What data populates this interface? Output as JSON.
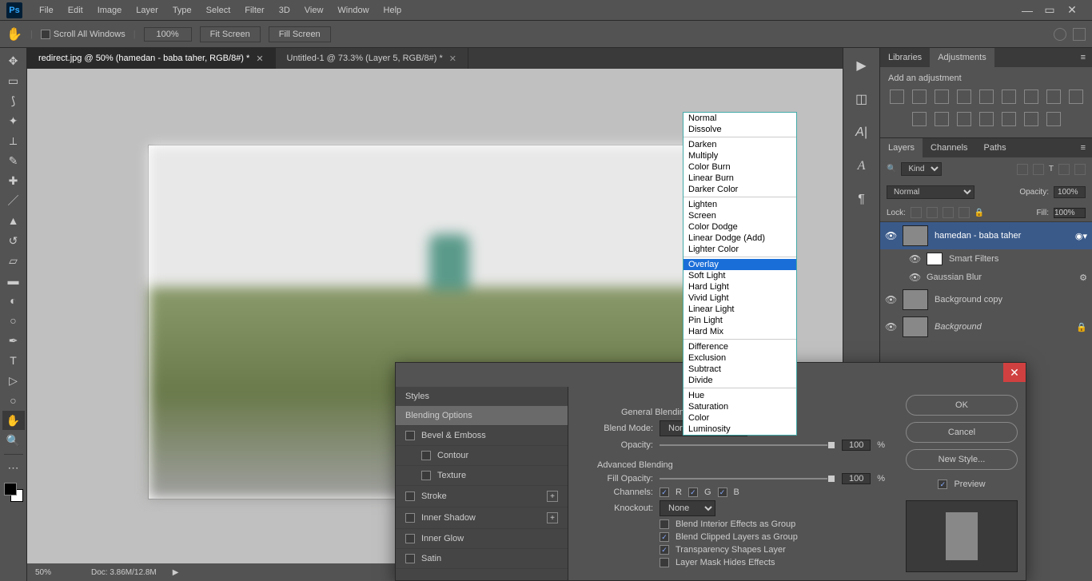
{
  "menubar": {
    "items": [
      "File",
      "Edit",
      "Image",
      "Layer",
      "Type",
      "Select",
      "Filter",
      "3D",
      "View",
      "Window",
      "Help"
    ]
  },
  "optbar": {
    "scroll_all": "Scroll All Windows",
    "zoom": "100%",
    "fit": "Fit Screen",
    "fill": "Fill Screen"
  },
  "tabs": [
    {
      "label": "redirect.jpg @ 50% (hamedan - baba taher, RGB/8#) *",
      "active": true
    },
    {
      "label": "Untitled-1 @ 73.3% (Layer 5, RGB/8#) *",
      "active": false
    }
  ],
  "status": {
    "zoom": "50%",
    "doc": "Doc: 3.86M/12.8M"
  },
  "panels": {
    "adj_tabs": [
      "Libraries",
      "Adjustments"
    ],
    "adj_title": "Add an adjustment",
    "layer_tabs": [
      "Layers",
      "Channels",
      "Paths"
    ],
    "kind": "Kind",
    "blend": "Normal",
    "opacity_label": "Opacity:",
    "opacity": "100%",
    "lock_label": "Lock:",
    "fill_label": "Fill:",
    "fill": "100%",
    "layers": [
      {
        "name": "hamedan - baba taher",
        "sel": true
      },
      {
        "name": "Smart Filters",
        "sub": true
      },
      {
        "name": "Gaussian Blur",
        "sub": true,
        "filter": true
      },
      {
        "name": "Background copy"
      },
      {
        "name": "Background",
        "locked": true,
        "italic": true
      }
    ]
  },
  "dialog": {
    "styles_title": "Styles",
    "left": [
      {
        "label": "Blending Options",
        "sel": true
      },
      {
        "label": "Bevel & Emboss",
        "chk": true
      },
      {
        "label": "Contour",
        "chk": true,
        "indent": true
      },
      {
        "label": "Texture",
        "chk": true,
        "indent": true
      },
      {
        "label": "Stroke",
        "chk": true,
        "plus": true
      },
      {
        "label": "Inner Shadow",
        "chk": true,
        "plus": true
      },
      {
        "label": "Inner Glow",
        "chk": true
      },
      {
        "label": "Satin",
        "chk": true
      }
    ],
    "section1": "Blending Options",
    "section1b": "General Blending",
    "blend_mode_label": "Blend Mode:",
    "blend_mode": "Normal",
    "opacity_label": "Opacity:",
    "opacity": "100",
    "pct": "%",
    "section2": "Advanced Blending",
    "fill_opacity_label": "Fill Opacity:",
    "fill_opacity": "100",
    "channels_label": "Channels:",
    "ch_r": "R",
    "ch_g": "G",
    "ch_b": "B",
    "knockout_label": "Knockout:",
    "knockout": "None",
    "opts": [
      {
        "label": "Blend Interior Effects as Group",
        "on": false
      },
      {
        "label": "Blend Clipped Layers as Group",
        "on": true
      },
      {
        "label": "Transparency Shapes Layer",
        "on": true
      },
      {
        "label": "Layer Mask Hides Effects",
        "on": false
      }
    ],
    "ok": "OK",
    "cancel": "Cancel",
    "new_style": "New Style...",
    "preview": "Preview"
  },
  "dropdown": {
    "groups": [
      [
        "Normal",
        "Dissolve"
      ],
      [
        "Darken",
        "Multiply",
        "Color Burn",
        "Linear Burn",
        "Darker Color"
      ],
      [
        "Lighten",
        "Screen",
        "Color Dodge",
        "Linear Dodge (Add)",
        "Lighter Color"
      ],
      [
        "Overlay",
        "Soft Light",
        "Hard Light",
        "Vivid Light",
        "Linear Light",
        "Pin Light",
        "Hard Mix"
      ],
      [
        "Difference",
        "Exclusion",
        "Subtract",
        "Divide"
      ],
      [
        "Hue",
        "Saturation",
        "Color",
        "Luminosity"
      ]
    ],
    "selected": "Overlay"
  }
}
